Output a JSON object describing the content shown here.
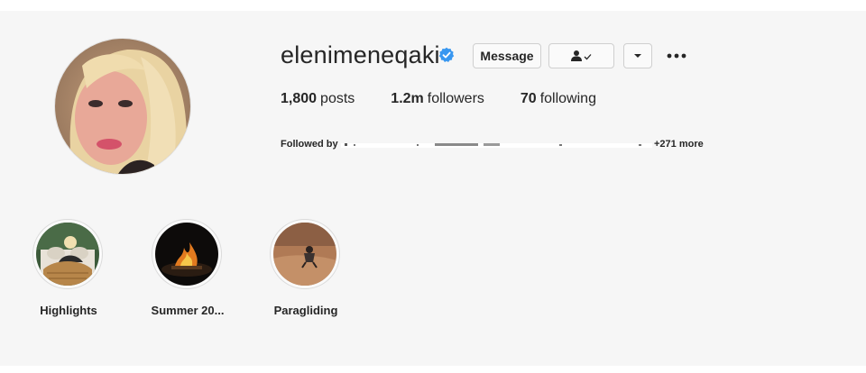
{
  "profile": {
    "username": "elenimeneqaki",
    "verified_icon": "verified-badge-icon",
    "message_label": "Message",
    "following_icon": "person-check-icon",
    "dropdown_icon": "chevron-down-icon",
    "more_icon": "more-dots-icon",
    "stats": {
      "posts_value": "1,800",
      "posts_label": "posts",
      "followers_value": "1.2m",
      "followers_label": "followers",
      "following_value": "70",
      "following_label": "following"
    },
    "followed_by_label": "Followed by",
    "followed_by_more": "+271 more"
  },
  "highlights": [
    {
      "label": "Highlights",
      "thumb": "woman-on-couch-image"
    },
    {
      "label": "Summer 20...",
      "thumb": "campfire-night-image"
    },
    {
      "label": "Paragliding",
      "thumb": "paragliding-landscape-image"
    }
  ],
  "colors": {
    "verified_blue": "#3897f0",
    "text": "#262626",
    "background": "#f6f6f6",
    "border": "#dbdbdb"
  }
}
